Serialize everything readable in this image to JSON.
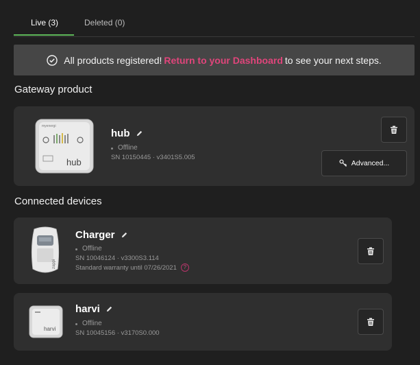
{
  "tabs": [
    {
      "label": "Live (3)",
      "active": true
    },
    {
      "label": "Deleted (0)",
      "active": false
    }
  ],
  "banner": {
    "prefix": "All products registered!",
    "link": "Return to your Dashboard",
    "suffix": "to see your next steps."
  },
  "sections": {
    "gateway": "Gateway product",
    "connected": "Connected devices"
  },
  "gateway": {
    "name": "hub",
    "status": "Offline",
    "serial": "SN 10150445 · v3401S5.005",
    "advanced_label": "Advanced...",
    "image_text": "hub",
    "image_brand": "myenergi"
  },
  "devices": [
    {
      "name": "Charger",
      "status": "Offline",
      "serial": "SN 10046124 · v3300S3.114",
      "warranty": "Standard warranty until 07/26/2021",
      "image_text": "zappi"
    },
    {
      "name": "harvi",
      "status": "Offline",
      "serial": "SN 10045156 · v3170S0.000",
      "image_text": "harvi"
    }
  ],
  "colors": {
    "accent_pink": "#e0457b",
    "tab_green": "#5fb85a",
    "card_bg": "#2f2f2f",
    "page_bg": "#1f1f1f"
  }
}
